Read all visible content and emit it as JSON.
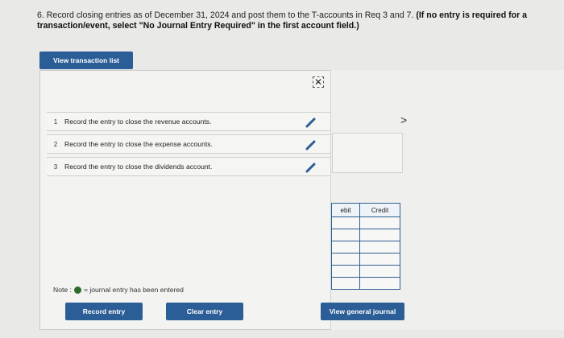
{
  "question": {
    "prefix": "6. Record closing entries as of December 31, 2024 and post them to the T-accounts in Req 3 and 7. ",
    "bold": "(If no entry is required for a transaction/event, select \"No Journal Entry Required\" in the first account field.)"
  },
  "view_transaction_list_label": "View transaction list",
  "transactions": [
    {
      "num": "1",
      "text": "Record the entry to close the revenue accounts."
    },
    {
      "num": "2",
      "text": "Record the entry to close the expense accounts."
    },
    {
      "num": "3",
      "text": "Record the entry to close the dividends account."
    }
  ],
  "close_glyph": "✕",
  "next_glyph": ">",
  "table": {
    "debit_header": "ebit",
    "credit_header": "Credit"
  },
  "note": {
    "label": "Note :",
    "text": "= journal entry has been entered"
  },
  "buttons": {
    "record": "Record entry",
    "clear": "Clear entry",
    "view_journal": "View general journal"
  },
  "colors": {
    "accent": "#2b5d96",
    "entered_dot": "#2e6b2e"
  }
}
